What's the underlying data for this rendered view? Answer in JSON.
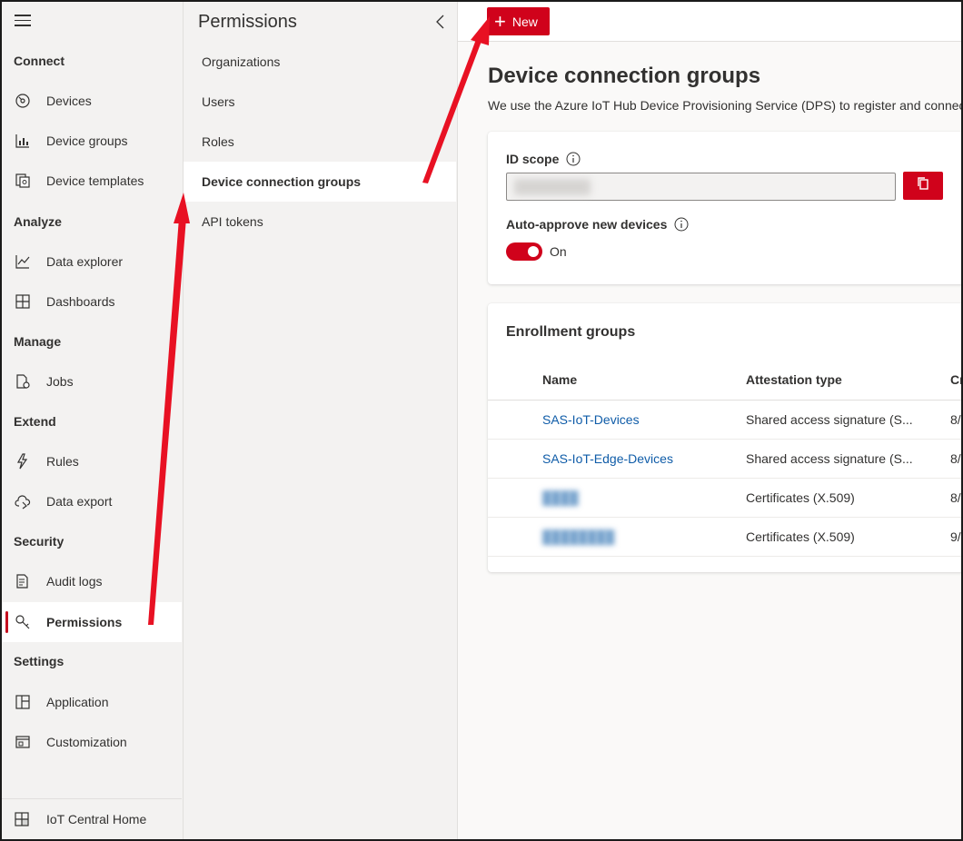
{
  "nav": {
    "sections": {
      "connect": "Connect",
      "analyze": "Analyze",
      "manage": "Manage",
      "extend": "Extend",
      "security": "Security",
      "settings": "Settings"
    },
    "items": {
      "devices": "Devices",
      "device_groups": "Device groups",
      "device_templates": "Device templates",
      "data_explorer": "Data explorer",
      "dashboards": "Dashboards",
      "jobs": "Jobs",
      "rules": "Rules",
      "data_export": "Data export",
      "audit_logs": "Audit logs",
      "permissions": "Permissions",
      "application": "Application",
      "customization": "Customization"
    },
    "home": "IoT Central Home",
    "active": "permissions"
  },
  "subnav": {
    "title": "Permissions",
    "items": [
      "Organizations",
      "Users",
      "Roles",
      "Device connection groups",
      "API tokens"
    ],
    "active": "Device connection groups"
  },
  "toolbar": {
    "new_label": "New"
  },
  "page": {
    "title": "Device connection groups",
    "description": "We use the Azure IoT Hub Device Provisioning Service (DPS) to register and connect"
  },
  "id_scope": {
    "label": "ID scope",
    "auto_approve_label": "Auto-approve new devices",
    "toggle_state": "On",
    "toggle_on": true
  },
  "enrollment": {
    "title": "Enrollment groups",
    "columns": [
      "Name",
      "Attestation type",
      "Cr"
    ],
    "rows": [
      {
        "name": "SAS-IoT-Devices",
        "type": "Shared access signature (S...",
        "created": "8/"
      },
      {
        "name": "SAS-IoT-Edge-Devices",
        "type": "Shared access signature (S...",
        "created": "8/"
      },
      {
        "name": "",
        "type": "Certificates (X.509)",
        "created": "8/"
      },
      {
        "name": "",
        "type": "Certificates (X.509)",
        "created": "9/"
      }
    ]
  },
  "colors": {
    "accent": "#d0021b",
    "link": "#0f5ca8",
    "nav_bg": "#f3f2f1",
    "arrow": "#e81123"
  }
}
